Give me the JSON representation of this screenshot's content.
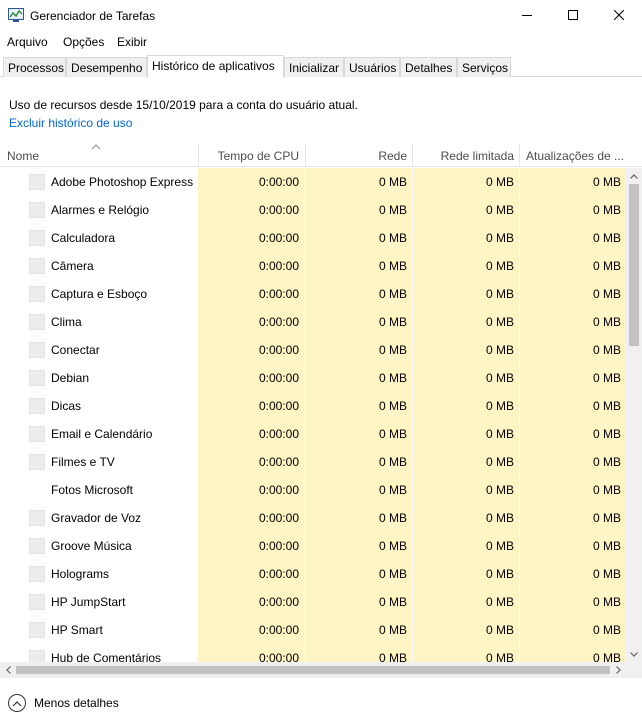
{
  "window": {
    "title": "Gerenciador de Tarefas",
    "app_icon": "task-manager-icon",
    "controls": [
      "minimize-icon",
      "maximize-icon",
      "close-icon"
    ]
  },
  "menu": [
    "Arquivo",
    "Opções",
    "Exibir"
  ],
  "tabs": [
    {
      "label": "Processos"
    },
    {
      "label": "Desempenho"
    },
    {
      "label": "Histórico de aplicativos",
      "active": true
    },
    {
      "label": "Inicializar"
    },
    {
      "label": "Usuários"
    },
    {
      "label": "Detalhes"
    },
    {
      "label": "Serviços"
    }
  ],
  "info": {
    "text": "Uso de recursos desde 15/10/2019 para a conta do usuário atual.",
    "link": "Excluir histórico de uso"
  },
  "columns": [
    "Nome",
    "Tempo de CPU",
    "Rede",
    "Rede limitada",
    "Atualizações de ..."
  ],
  "rows": [
    {
      "name": "Adobe Photoshop Express",
      "cpu": "0:00:00",
      "net": "0 MB",
      "metered": "0 MB",
      "updates": "0 MB",
      "icon": true
    },
    {
      "name": "Alarmes e Relógio",
      "cpu": "0:00:00",
      "net": "0 MB",
      "metered": "0 MB",
      "updates": "0 MB",
      "icon": true
    },
    {
      "name": "Calculadora",
      "cpu": "0:00:00",
      "net": "0 MB",
      "metered": "0 MB",
      "updates": "0 MB",
      "icon": true
    },
    {
      "name": "Câmera",
      "cpu": "0:00:00",
      "net": "0 MB",
      "metered": "0 MB",
      "updates": "0 MB",
      "icon": true
    },
    {
      "name": "Captura e Esboço",
      "cpu": "0:00:00",
      "net": "0 MB",
      "metered": "0 MB",
      "updates": "0 MB",
      "icon": true
    },
    {
      "name": "Clima",
      "cpu": "0:00:00",
      "net": "0 MB",
      "metered": "0 MB",
      "updates": "0 MB",
      "icon": true
    },
    {
      "name": "Conectar",
      "cpu": "0:00:00",
      "net": "0 MB",
      "metered": "0 MB",
      "updates": "0 MB",
      "icon": true
    },
    {
      "name": "Debian",
      "cpu": "0:00:00",
      "net": "0 MB",
      "metered": "0 MB",
      "updates": "0 MB",
      "icon": true
    },
    {
      "name": "Dicas",
      "cpu": "0:00:00",
      "net": "0 MB",
      "metered": "0 MB",
      "updates": "0 MB",
      "icon": true
    },
    {
      "name": "Email e Calendário",
      "cpu": "0:00:00",
      "net": "0 MB",
      "metered": "0 MB",
      "updates": "0 MB",
      "icon": true
    },
    {
      "name": "Filmes e TV",
      "cpu": "0:00:00",
      "net": "0 MB",
      "metered": "0 MB",
      "updates": "0 MB",
      "icon": true
    },
    {
      "name": "Fotos Microsoft",
      "cpu": "0:00:00",
      "net": "0 MB",
      "metered": "0 MB",
      "updates": "0 MB",
      "icon": false
    },
    {
      "name": "Gravador de Voz",
      "cpu": "0:00:00",
      "net": "0 MB",
      "metered": "0 MB",
      "updates": "0 MB",
      "icon": true
    },
    {
      "name": "Groove Música",
      "cpu": "0:00:00",
      "net": "0 MB",
      "metered": "0 MB",
      "updates": "0 MB",
      "icon": true
    },
    {
      "name": "Holograms",
      "cpu": "0:00:00",
      "net": "0 MB",
      "metered": "0 MB",
      "updates": "0 MB",
      "icon": true
    },
    {
      "name": "HP JumpStart",
      "cpu": "0:00:00",
      "net": "0 MB",
      "metered": "0 MB",
      "updates": "0 MB",
      "icon": true
    },
    {
      "name": "HP Smart",
      "cpu": "0:00:00",
      "net": "0 MB",
      "metered": "0 MB",
      "updates": "0 MB",
      "icon": true
    },
    {
      "name": "Hub de Comentários",
      "cpu": "0:00:00",
      "net": "0 MB",
      "metered": "0 MB",
      "updates": "0 MB",
      "icon": true
    }
  ],
  "footer": {
    "label": "Menos detalhes"
  },
  "colors": {
    "highlight_column": "#fff4c4",
    "link": "#0066cc"
  }
}
